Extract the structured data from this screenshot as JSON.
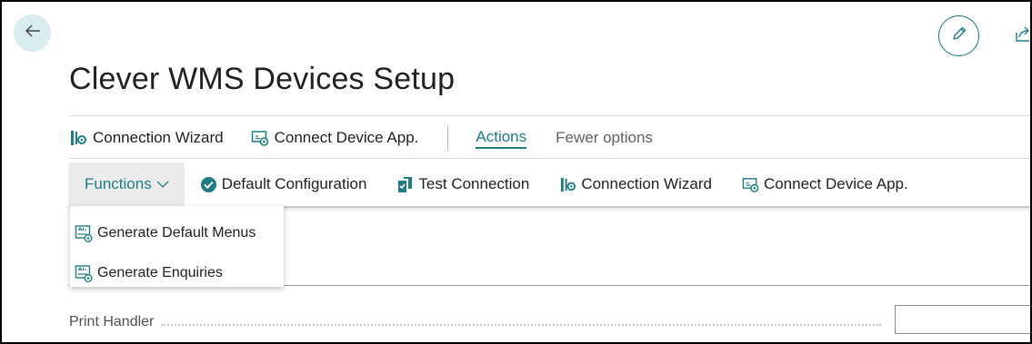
{
  "page": {
    "title": "Clever WMS Devices Setup"
  },
  "header_icons": {
    "back": "arrow-left-icon",
    "edit": "pencil-icon",
    "share": "share-icon"
  },
  "promoted_actions": {
    "items": [
      {
        "label": "Connection Wizard",
        "icon": "wizard-icon"
      },
      {
        "label": "Connect Device App.",
        "icon": "connect-device-icon"
      }
    ],
    "tabs": {
      "actions": "Actions",
      "fewer_options": "Fewer options"
    }
  },
  "action_bar": {
    "functions_label": "Functions",
    "items": [
      {
        "label": "Default Configuration",
        "icon": "check-circle-icon"
      },
      {
        "label": "Test Connection",
        "icon": "test-connection-icon"
      },
      {
        "label": "Connection Wizard",
        "icon": "wizard-icon"
      },
      {
        "label": "Connect Device App.",
        "icon": "connect-device-icon"
      }
    ]
  },
  "functions_menu": {
    "items": [
      {
        "label": "Generate Default Menus",
        "icon": "generate-icon"
      },
      {
        "label": "Generate Enquiries",
        "icon": "generate-icon"
      }
    ]
  },
  "fields": {
    "print_handler": {
      "label": "Print Handler",
      "value": ""
    }
  },
  "colors": {
    "accent": "#1e7d83",
    "back_button_bg": "#d9edee",
    "functions_bg": "#ebebeb"
  }
}
